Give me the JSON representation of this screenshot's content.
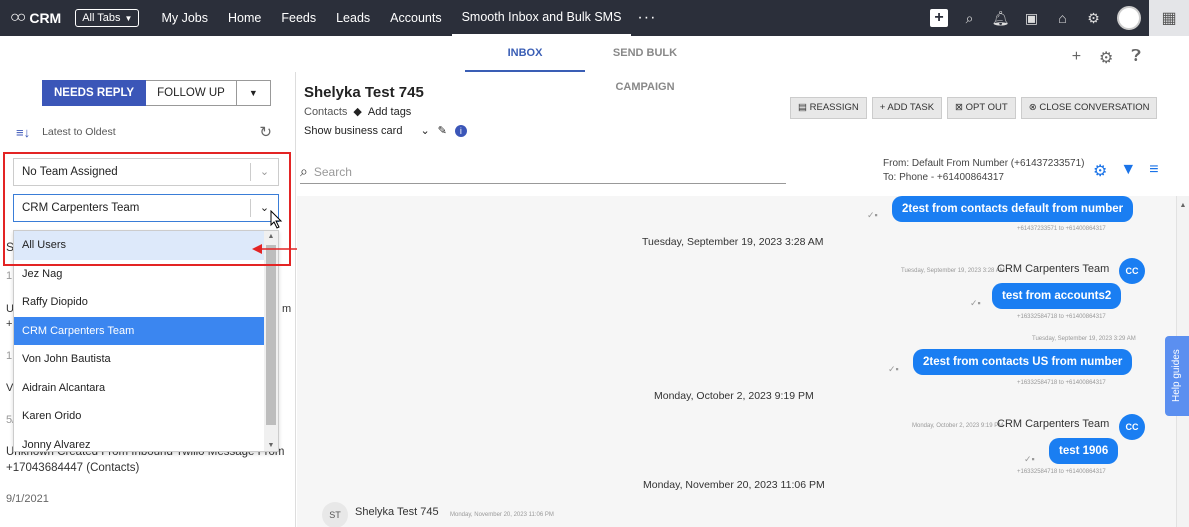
{
  "topbar": {
    "app_name": "CRM",
    "all_tabs": "All Tabs",
    "nav": [
      "My Jobs",
      "Home",
      "Feeds",
      "Leads",
      "Accounts",
      "Smooth Inbox and Bulk SMS"
    ],
    "more": "···"
  },
  "subtabs": [
    "INBOX",
    "SEND BULK CAMPAIGN"
  ],
  "left": {
    "needs_reply": "NEEDS REPLY",
    "follow_up": "FOLLOW UP",
    "sort": "Latest to Oldest",
    "team_select": "No Team Assigned",
    "team_select2": "CRM Carpenters Team",
    "dropdown": [
      "All Users",
      "Jez Nag",
      "Raffy Diopido",
      "CRM Carpenters Team",
      "Von John Bautista",
      "Aidrain Alcantara",
      "Karen Orido",
      "Jonny Alvarez"
    ],
    "behind_text": [
      "Unknown Created From Inbound Twilio Message From",
      "+17043684447 (Contacts)",
      "9/1/2021"
    ]
  },
  "contact": {
    "name": "Shelyka Test 745",
    "contacts_label": "Contacts",
    "add_tags": "Add tags",
    "show_business_card": "Show business card"
  },
  "actions": [
    "REASSIGN",
    "ADD TASK",
    "OPT OUT",
    "CLOSE CONVERSATION"
  ],
  "search_placeholder": "Search",
  "from": {
    "line1": "From: Default From Number (+61437233571)",
    "line2": "To: Phone - +61400864317"
  },
  "messages": {
    "m1": "2test from contacts default from number",
    "m1_meta": "+61437233571 to +61400864317",
    "sep1": "Tuesday, September 19, 2023 3:28 AM",
    "m2_sender": "CRM Carpenters Team",
    "m2_time": "Tuesday, September 19, 2023 3:28 AM",
    "m2": "test from accounts2",
    "m2_meta": "+16332584718 to +61400864317",
    "m3_time": "Tuesday, September 19, 2023 3:29 AM",
    "m3": "2test from contacts US from number",
    "m3_meta": "+16332584718 to +61400864317",
    "sep2": "Monday, October 2, 2023 9:19 PM",
    "m4_sender": "CRM Carpenters Team",
    "m4_time": "Monday, October 2, 2023 9:19 PM",
    "m4": "test 1906",
    "m4_meta": "+16332584718 to +61400864317",
    "sep3": "Monday, November 20, 2023 11:06 PM",
    "m5_sender": "Shelyka Test 745",
    "m5_time": "Monday, November 20, 2023 11:06 PM",
    "cc": "CC",
    "st": "ST"
  },
  "help": "Help guides",
  "icons": [
    "crm-logo-icon",
    "search-icon",
    "bell-icon",
    "gear-icon",
    "grid-icon",
    "plus-icon",
    "question-icon",
    "filter-icon",
    "menu-icon"
  ]
}
